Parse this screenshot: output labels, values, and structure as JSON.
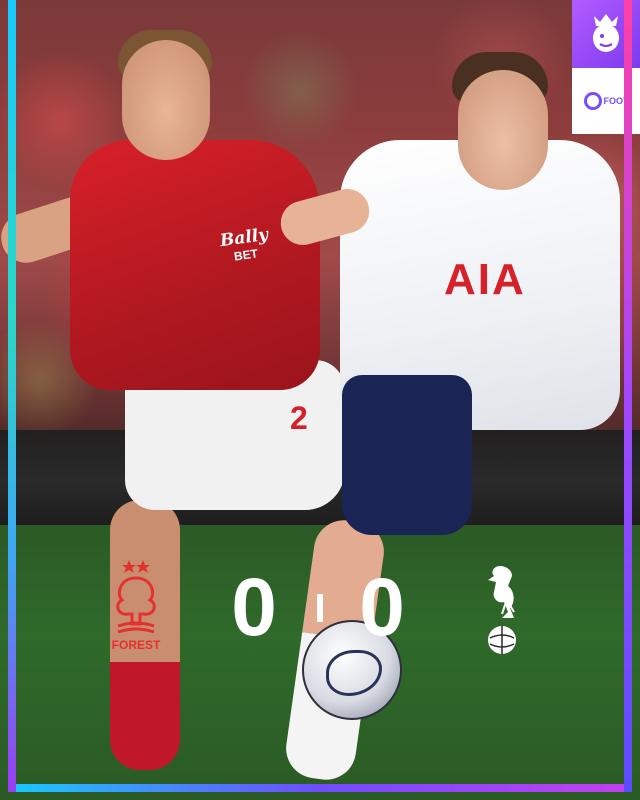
{
  "overlay": {
    "score_home": "0",
    "score_away": "0",
    "home_team_label": "FOREST",
    "home_crest_icon": "nottingham-forest-crest-icon",
    "away_crest_icon": "tottenham-hotspur-crest-icon"
  },
  "branding": {
    "league_logo_icon": "premier-league-lion-icon",
    "publisher_logo_icon": "onefootball-logo-icon",
    "publisher_text": "FOOT"
  },
  "kits": {
    "forest_sponsor": "Bally",
    "forest_sponsor_sub": "BET",
    "forest_number": "2",
    "spurs_sponsor": "AIA"
  },
  "colors": {
    "forest_red": "#d6202a",
    "spurs_navy": "#1a2455",
    "frame_gradient": [
      "#19c9ff",
      "#6f4cff",
      "#c43ff0"
    ]
  }
}
